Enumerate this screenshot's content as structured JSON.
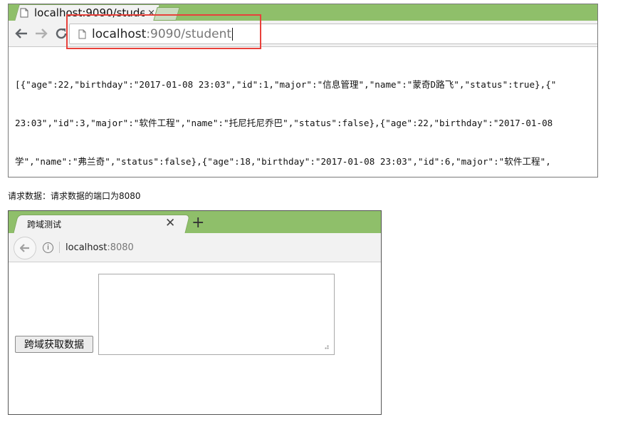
{
  "browser1": {
    "tab_title": "localhost:9090/stude",
    "tab_close": "×",
    "address": {
      "host": "localhost",
      "rest": ":9090/student"
    },
    "json_lines": [
      "[{\"age\":22,\"birthday\":\"2017-01-08 23:03\",\"id\":1,\"major\":\"信息管理\",\"name\":\"蒙奇D路飞\",\"status\":true},{\"",
      "23:03\",\"id\":3,\"major\":\"软件工程\",\"name\":\"托尼托尼乔巴\",\"status\":false},{\"age\":22,\"birthday\":\"2017-01-08",
      "学\",\"name\":\"弗兰奇\",\"status\":false},{\"age\":18,\"birthday\":\"2017-01-08 23:03\",\"id\":6,\"major\":\"软件工程\","
    ]
  },
  "caption": "请求数据：请求数据的端口为8080",
  "browser2": {
    "tab_title": "跨域测试",
    "tab_close": "✕",
    "new_tab": "+",
    "address": {
      "host": "localhost",
      "rest": ":8080"
    },
    "fetch_button": "跨域获取数据",
    "result_value": ""
  },
  "colors": {
    "tabstrip": "#8fbf6a",
    "highlight": "#e8413b"
  }
}
